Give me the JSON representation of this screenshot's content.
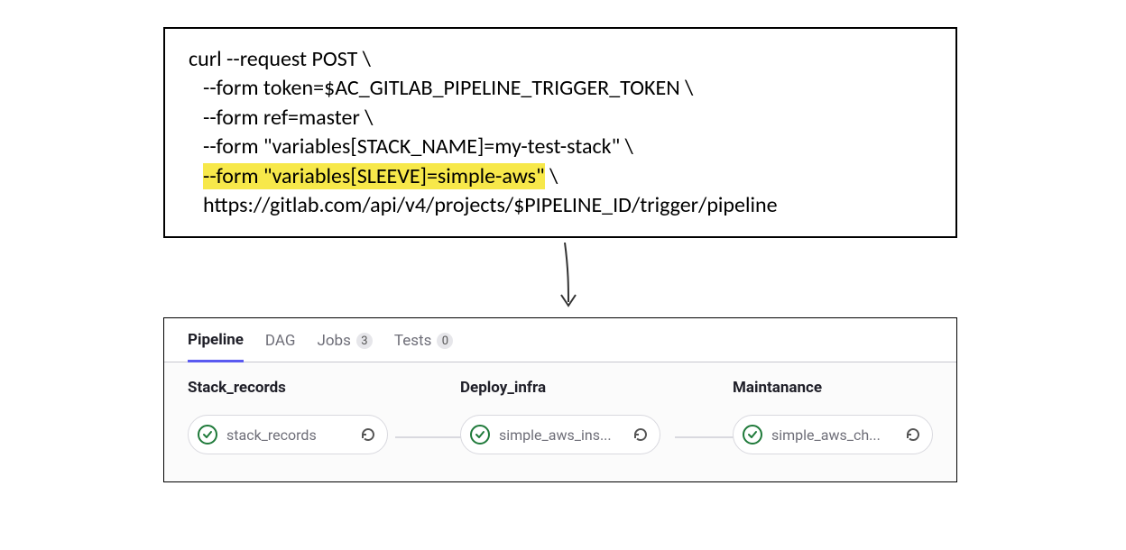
{
  "code": {
    "line1": "curl --request POST \\",
    "line2": "--form token=$AC_GITLAB_PIPELINE_TRIGGER_TOKEN \\",
    "line3": "--form ref=master \\",
    "line4": "--form \"variables[STACK_NAME]=my-test-stack\" \\",
    "line5_hl": "--form \"variables[SLEEVE]=simple-aws\"",
    "line5_tail": " \\",
    "line6": "https://gitlab.com/api/v4/projects/$PIPELINE_ID/trigger/pipeline"
  },
  "tabs": {
    "pipeline": "Pipeline",
    "dag": "DAG",
    "jobs": {
      "label": "Jobs",
      "count": "3"
    },
    "tests": {
      "label": "Tests",
      "count": "0"
    }
  },
  "stages": {
    "stack_records": {
      "title": "Stack_records",
      "job": "stack_records"
    },
    "deploy_infra": {
      "title": "Deploy_infra",
      "job": "simple_aws_ins..."
    },
    "maintanance": {
      "title": "Maintanance",
      "job": "simple_aws_ch..."
    }
  }
}
